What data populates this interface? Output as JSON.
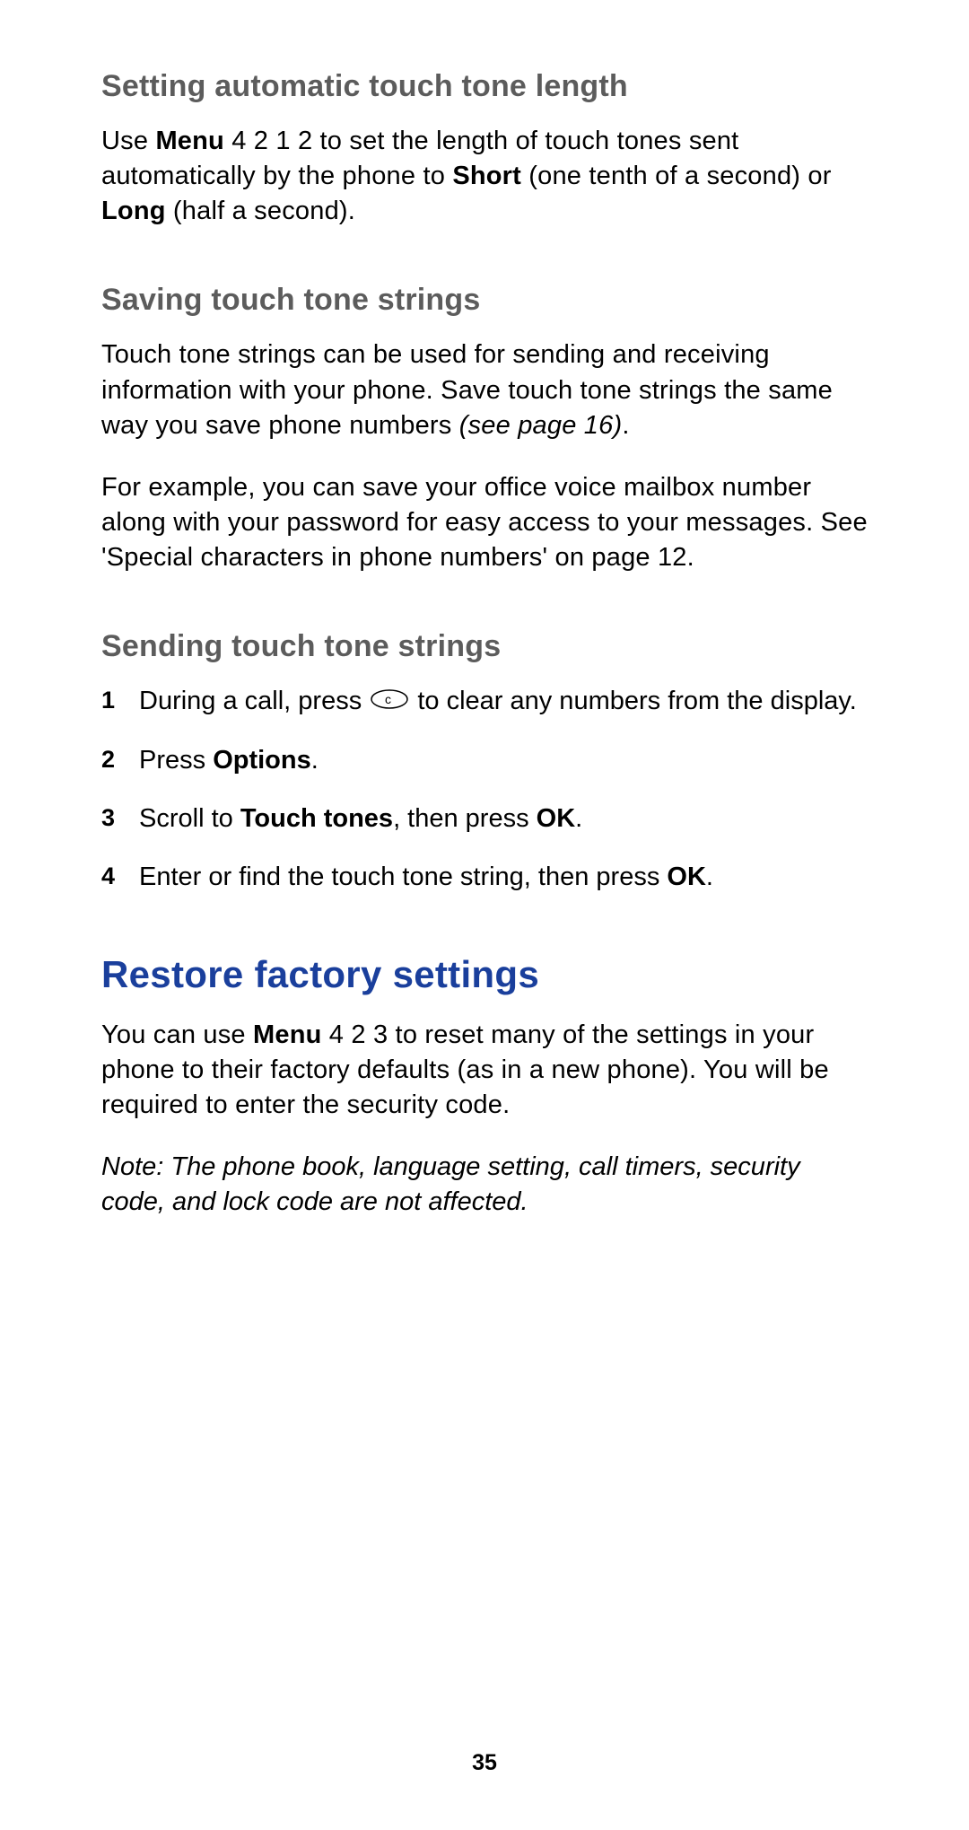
{
  "section1": {
    "heading": "Setting automatic touch tone length",
    "para1_a": "Use ",
    "para1_bold1": "Menu",
    "para1_b": " 4 2 1 2 to set the length of touch tones sent automatically by the phone to ",
    "para1_bold2": "Short",
    "para1_c": " (one tenth of a second) or ",
    "para1_bold3": "Long",
    "para1_d": " (half a second)."
  },
  "section2": {
    "heading": "Saving touch tone strings",
    "para1_a": "Touch tone strings can be used for sending and receiving information with your phone. Save touch tone strings the same way you save phone numbers ",
    "para1_italic": "(see page 16)",
    "para1_b": ".",
    "para2": "For example, you can save your office voice mailbox number along with your password for easy access to your messages. See 'Special characters in phone numbers' on page 12."
  },
  "section3": {
    "heading": "Sending touch tone strings",
    "items": {
      "n1": "1",
      "i1a": "During a call, press ",
      "i1b": " to clear any numbers from the display.",
      "n2": "2",
      "i2a": "Press ",
      "i2bold": "Options",
      "i2b": ".",
      "n3": "3",
      "i3a": "Scroll to ",
      "i3bold1": "Touch tones",
      "i3b": ", then press ",
      "i3bold2": "OK",
      "i3c": ".",
      "n4": "4",
      "i4a": "Enter or find the touch tone string, then press ",
      "i4bold": "OK",
      "i4b": "."
    }
  },
  "section4": {
    "heading": "Restore factory settings",
    "para1_a": "You can use ",
    "para1_bold": "Menu",
    "para1_b": " 4 2 3 to reset many of the settings in your phone to their factory defaults (as in a new phone). You will be required to enter the security code.",
    "note": "Note:  The phone book, language setting, call timers, security code, and lock code are not affected."
  },
  "pageNumber": "35"
}
